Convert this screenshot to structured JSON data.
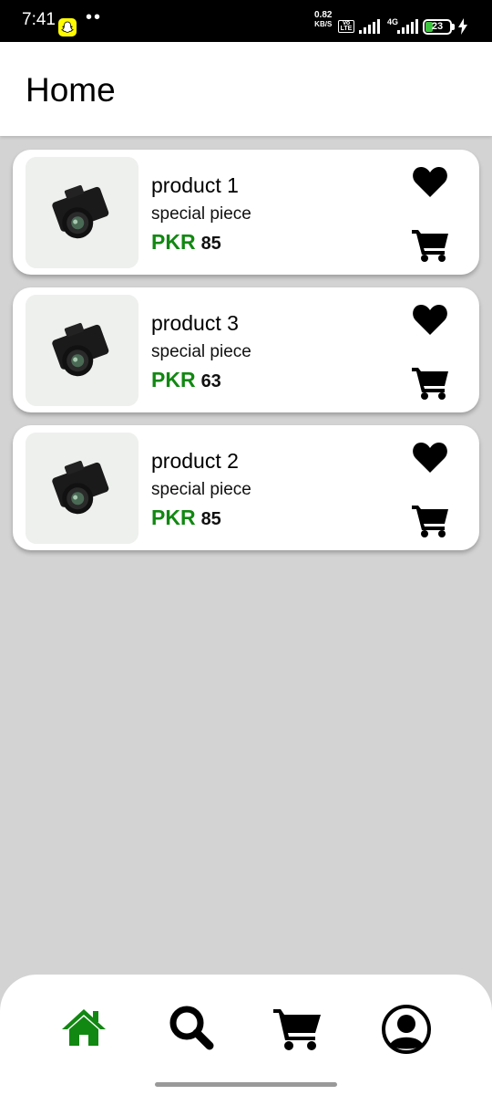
{
  "status_bar": {
    "time": "7:41",
    "dots": "••",
    "net_speed_value": "0.82",
    "net_speed_unit": "KB/S",
    "volte_top": "Vo",
    "volte_bottom": "LTE",
    "network": "4G",
    "battery": "23"
  },
  "header": {
    "title": "Home"
  },
  "products": [
    {
      "name": "product 1",
      "description": "special piece",
      "currency": "PKR",
      "price": "85"
    },
    {
      "name": "product 3",
      "description": "special piece",
      "currency": "PKR",
      "price": "63"
    },
    {
      "name": "product 2",
      "description": "special piece",
      "currency": "PKR",
      "price": "85"
    }
  ],
  "bottom_nav": {
    "items": [
      {
        "icon": "home-icon",
        "active": true
      },
      {
        "icon": "search-icon",
        "active": false
      },
      {
        "icon": "cart-icon",
        "active": false
      },
      {
        "icon": "profile-icon",
        "active": false
      }
    ]
  },
  "colors": {
    "accent_green": "#118811",
    "background": "#d3d3d3",
    "card": "#ffffff"
  }
}
